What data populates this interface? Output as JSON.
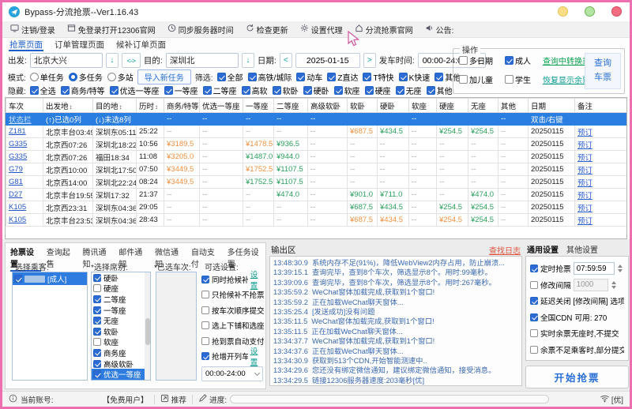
{
  "window": {
    "title": "Bypass-分流抢票--Ver1.16.43"
  },
  "menubar": {
    "items": [
      {
        "id": "logout",
        "icon": "monitor-icon",
        "label": "注销/登录"
      },
      {
        "id": "open12306",
        "icon": "browser-icon",
        "label": "免登录打开12306官网"
      },
      {
        "id": "sync-time",
        "icon": "clock-icon",
        "label": "同步服务器时间"
      },
      {
        "id": "check-update",
        "icon": "refresh-icon",
        "label": "检查更新"
      },
      {
        "id": "proxy",
        "icon": "gear-icon",
        "label": "设置代理"
      },
      {
        "id": "official-site",
        "icon": "home-icon",
        "label": "分流抢票官网"
      },
      {
        "id": "notice",
        "icon": "speaker-icon",
        "label": "公告:"
      }
    ]
  },
  "tabs": {
    "items": [
      "抢票页面",
      "订单管理页面",
      "候补订单页面"
    ],
    "active": 0
  },
  "query": {
    "depart_label": "出发:",
    "depart_value": "北京大兴",
    "swap_label": "<->",
    "dest_label": "目的:",
    "dest_value": "深圳北",
    "date_label": "日期:",
    "date_value": "2025-01-15",
    "time_label": "发车时间:",
    "time_value": "00:00-24:00",
    "mode": {
      "label": "模式:",
      "options": [
        {
          "label": "单任务",
          "on": false
        },
        {
          "label": "多任务",
          "on": true
        },
        {
          "label": "多站",
          "on": false
        }
      ],
      "import_button": "导入新任务"
    },
    "filter": {
      "label": "筛选:",
      "items": [
        "全部",
        "高铁/城际",
        "动车",
        "Z直达",
        "T特快",
        "K快速",
        "其他"
      ]
    },
    "hide": {
      "label": "隐藏:",
      "items": [
        "全选",
        "商务/特等",
        "优选一等座",
        "一等座",
        "二等座",
        "高软",
        "软卧",
        "硬卧",
        "软座",
        "硬座",
        "无座",
        "其他"
      ]
    }
  },
  "ops": {
    "title": "操作",
    "multi_date": {
      "label": "多日期",
      "on": false
    },
    "adult": {
      "label": "成人",
      "on": true
    },
    "child": {
      "label": "加儿童",
      "on": false
    },
    "student": {
      "label": "学生",
      "on": false
    },
    "transfer_link": "查询中转换乘",
    "restore_link": "恢复显示余票",
    "query_button": "查询车票"
  },
  "table": {
    "columns": [
      {
        "label": "车次"
      },
      {
        "label": "出发地",
        "sort": true
      },
      {
        "label": "目的地",
        "sort": true
      },
      {
        "label": "历时",
        "sort": true
      },
      {
        "label": "商务/特等"
      },
      {
        "label": "优选一等座"
      },
      {
        "label": "一等座"
      },
      {
        "label": "二等座"
      },
      {
        "label": "高级软卧"
      },
      {
        "label": "软卧"
      },
      {
        "label": "硬卧"
      },
      {
        "label": "软座"
      },
      {
        "label": "硬座"
      },
      {
        "label": "无座"
      },
      {
        "label": "其他"
      },
      {
        "label": "日期"
      },
      {
        "label": "备注"
      }
    ],
    "status_row": {
      "name": "状态栏",
      "selected": "(↑)已选0列",
      "unselected": "(↓)未选8列",
      "dur": "",
      "prices": [
        "--",
        "--",
        "--",
        "--",
        "--",
        "",
        "",
        "--",
        "",
        "",
        "--"
      ],
      "date": "双击/右键",
      "action": ""
    },
    "rows": [
      {
        "train": "Z181",
        "from": "北京丰台03:49",
        "to": "深圳东05:11",
        "dur": "25:22",
        "prices": [
          null,
          null,
          null,
          null,
          null,
          {
            "v": "¥687.5",
            "t": "o"
          },
          {
            "v": "¥434.5",
            "t": "g"
          },
          null,
          {
            "v": "¥254.5",
            "t": "g"
          },
          {
            "v": "¥254.5",
            "t": "g"
          },
          null
        ],
        "date": "20250115",
        "action": "预订"
      },
      {
        "train": "G335",
        "from": "北京西07:26",
        "to": "深圳北18:22",
        "dur": "10:56",
        "prices": [
          {
            "v": "¥3189.5",
            "t": "o"
          },
          null,
          {
            "v": "¥1478.5",
            "t": "o"
          },
          {
            "v": "¥936.5",
            "t": "g"
          },
          null,
          null,
          null,
          null,
          null,
          null,
          null
        ],
        "date": "20250115",
        "action": "预订"
      },
      {
        "train": "G335",
        "from": "北京西07:26",
        "to": "福田18:34",
        "dur": "11:08",
        "prices": [
          {
            "v": "¥3205.0",
            "t": "o"
          },
          null,
          {
            "v": "¥1487.0",
            "t": "g"
          },
          {
            "v": "¥944.0",
            "t": "g"
          },
          null,
          null,
          null,
          null,
          null,
          null,
          null
        ],
        "date": "20250115",
        "action": "预订"
      },
      {
        "train": "G79",
        "from": "北京西10:00",
        "to": "深圳北17:50",
        "dur": "07:50",
        "prices": [
          {
            "v": "¥3449.5",
            "t": "o"
          },
          null,
          {
            "v": "¥1752.5",
            "t": "o"
          },
          {
            "v": "¥1107.5",
            "t": "g"
          },
          null,
          null,
          null,
          null,
          null,
          null,
          null
        ],
        "date": "20250115",
        "action": "预订"
      },
      {
        "train": "G81",
        "from": "北京西14:00",
        "to": "深圳北22:24",
        "dur": "08:24",
        "prices": [
          {
            "v": "¥3449.5",
            "t": "o"
          },
          null,
          {
            "v": "¥1752.5",
            "t": "g"
          },
          {
            "v": "¥1107.5",
            "t": "g"
          },
          null,
          null,
          null,
          null,
          null,
          null,
          null
        ],
        "date": "20250115",
        "action": "预订"
      },
      {
        "train": "D27",
        "from": "北京丰台19:55",
        "to": "深圳17:32",
        "dur": "21:37",
        "prices": [
          null,
          null,
          null,
          {
            "v": "¥474.0",
            "t": "g"
          },
          null,
          {
            "v": "¥901.0",
            "t": "g"
          },
          {
            "v": "¥711.0",
            "t": "g"
          },
          null,
          null,
          {
            "v": "¥474.0",
            "t": "g"
          },
          null
        ],
        "date": "20250115",
        "action": "预订"
      },
      {
        "train": "K105",
        "from": "北京西23:31",
        "to": "深圳东04:36",
        "dur": "29:05",
        "prices": [
          null,
          null,
          null,
          null,
          null,
          {
            "v": "¥687.5",
            "t": "g"
          },
          {
            "v": "¥434.5",
            "t": "g"
          },
          null,
          {
            "v": "¥254.5",
            "t": "g"
          },
          {
            "v": "¥254.5",
            "t": "g"
          },
          null
        ],
        "date": "20250115",
        "action": "预订"
      },
      {
        "train": "K105",
        "from": "北京丰台23:53",
        "to": "深圳东04:36",
        "dur": "28:43",
        "prices": [
          null,
          null,
          null,
          null,
          null,
          {
            "v": "¥687.5",
            "t": "o"
          },
          {
            "v": "¥434.5",
            "t": "o"
          },
          null,
          {
            "v": "¥254.5",
            "t": "o"
          },
          {
            "v": "¥254.5",
            "t": "g"
          },
          null
        ],
        "date": "20250115",
        "action": "预订"
      }
    ]
  },
  "bottom": {
    "tabs": [
      "抢票设置",
      "查询起售",
      "腾讯通知",
      "邮件通知",
      "微信通知",
      "自动支付",
      "多任务设置"
    ],
    "active_tab": 0,
    "passenger_header": "*选择乘客:",
    "passenger": {
      "type": "[成人]",
      "checked": true
    },
    "seat_header": "*选择席别:",
    "seats": [
      {
        "label": "硬卧",
        "on": true
      },
      {
        "label": "硬座",
        "on": false
      },
      {
        "label": "二等座",
        "on": true
      },
      {
        "label": "一等座",
        "on": true
      },
      {
        "label": "无座",
        "on": true
      },
      {
        "label": "软卧",
        "on": true
      },
      {
        "label": "软座",
        "on": false
      },
      {
        "label": "商务座",
        "on": true
      },
      {
        "label": "高级软卧",
        "on": true
      },
      {
        "label": "优选一等座",
        "on": true,
        "selected": true
      }
    ],
    "trains_header": "*已选车次:",
    "options_header": "可选设置:",
    "options": [
      {
        "label": "同时抢候补",
        "on": true,
        "link": "设置"
      },
      {
        "label": "只抢候补不抢票",
        "on": false
      },
      {
        "label": "按车次顺序提交",
        "on": false
      },
      {
        "label": "选上下铺和选座",
        "on": false
      },
      {
        "label": "抢到票自动支付",
        "on": false
      },
      {
        "label": "抢增开列车",
        "on": true,
        "link": "设置"
      }
    ],
    "time_range": "00:00-24:00"
  },
  "output": {
    "title": "输出区",
    "find_log": "查找日志",
    "lines": [
      {
        "time": "13:48:30.9",
        "text": "系统内存不足(91%)，降低WebView2内存占用，防止崩溃..."
      },
      {
        "time": "13:39:15.1",
        "text": "查询完毕，查到8个车次，筛选显示8个。用时:99毫秒。"
      },
      {
        "time": "13:39:09.6",
        "text": "查询完毕，查到8个车次，筛选显示8个。用时:267毫秒。"
      },
      {
        "time": "13:35:59.2",
        "text": "WeChat窗体加载完成,获取到1个窗口!"
      },
      {
        "time": "13:35:59.2",
        "text": "正在加载WeChat聊天窗体..."
      },
      {
        "time": "13:35:25.4",
        "text": "[发送成功]没有问题"
      },
      {
        "time": "13:35:11.5",
        "text": "WeChat窗体加载完成,获取到1个窗口!"
      },
      {
        "time": "13:35:11.5",
        "text": "正在加载WeChat聊天窗体..."
      },
      {
        "time": "13:34:37.7",
        "text": "WeChat窗体加载完成,获取到1个窗口!"
      },
      {
        "time": "13:34:37.6",
        "text": "正在加载WeChat聊天窗体..."
      },
      {
        "time": "13:34:30.9",
        "text": "获取到513个CDN,开始智能测速中.."
      },
      {
        "time": "13:34:29.6",
        "text": "您还没有绑定微信通知，建议绑定微信通知，接受消息。"
      },
      {
        "time": "13:34:29.5",
        "text": "链接12306服务器速度:203毫秒[优]"
      }
    ]
  },
  "general": {
    "tabs": [
      "通用设置",
      "其他设置"
    ],
    "active_tab": 0,
    "timed": {
      "label": "定时抢票",
      "on": true,
      "value": "07:59:59"
    },
    "interval": {
      "label": "修改间隔",
      "on": false,
      "value": "1000"
    },
    "delay": {
      "label": "延迟关闭 [修改间隔] 选项",
      "on": true
    },
    "cdn": {
      "label": "全国CDN",
      "extra": "可用: 270",
      "on": true
    },
    "no_seat": {
      "label": "实时余票无座时,不提交",
      "on": false
    },
    "partial": {
      "label": "余票不足乘客时,部分提交",
      "on": false
    },
    "start_button": "开始抢票"
  },
  "statusbar": {
    "account_label": "当前账号:",
    "account_value": "【免费用户】",
    "push": "推荐",
    "progress_label": "进度:",
    "signal": "[优]"
  }
}
